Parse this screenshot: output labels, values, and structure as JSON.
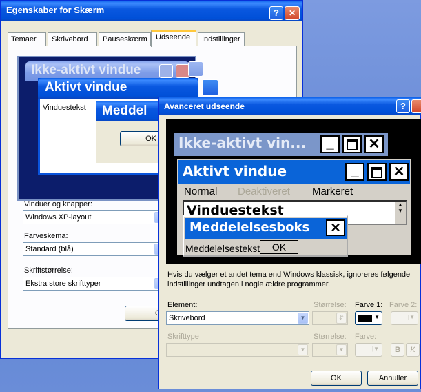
{
  "props_window": {
    "title": "Egenskaber for Skærm",
    "help_btn": "?",
    "close_btn": "✕",
    "tabs": [
      "Temaer",
      "Skrivebord",
      "Pauseskærm",
      "Udseende",
      "Indstillinger"
    ],
    "preview": {
      "inactive_title": "Ikke-aktivt vindue",
      "active_title": "Aktivt vindue",
      "window_text": "Vinduestekst",
      "message_title": "Meddel",
      "ok": "OK"
    },
    "windows_buttons_label": "Vinduer og knapper:",
    "windows_buttons_value": "Windows XP-layout",
    "color_scheme_label": "Farveskema:",
    "color_scheme_value": "Standard (blå)",
    "font_size_label": "Skriftstørrelse:",
    "font_size_value": "Ekstra store skrifttyper",
    "ok_partial": "Ol"
  },
  "adv_window": {
    "title": "Avanceret udseende",
    "help_btn": "?",
    "preview": {
      "inactive_title": "Ikke-aktivt vin...",
      "active_title": "Aktivt vindue",
      "menu": [
        "Normal",
        "Deaktiveret",
        "Markeret"
      ],
      "window_text": "Vinduestekst",
      "message_title": "Meddelelsesboks",
      "message_text": "Meddelelsestekst",
      "ok": "OK"
    },
    "info_text": "Hvis du vælger et andet tema end Windows klassisk, ignoreres følgende indstillinger undtagen i nogle ældre programmer.",
    "element_label": "Element:",
    "element_value": "Skrivebord",
    "size_label": "Størrelse:",
    "color1_label": "Farve 1:",
    "color2_label": "Farve 2:",
    "font_label": "Skrifttype",
    "font_size_label": "Størrelse:",
    "font_color_label": "Farve:",
    "bold_btn": "B",
    "italic_btn": "K",
    "ok": "OK",
    "cancel": "Annuller",
    "colors": {
      "color1": "#000000",
      "preview_bg": "#000000",
      "active_title_bg": "#0a64d8",
      "inactive_title_bg": "#7b96c9"
    }
  }
}
